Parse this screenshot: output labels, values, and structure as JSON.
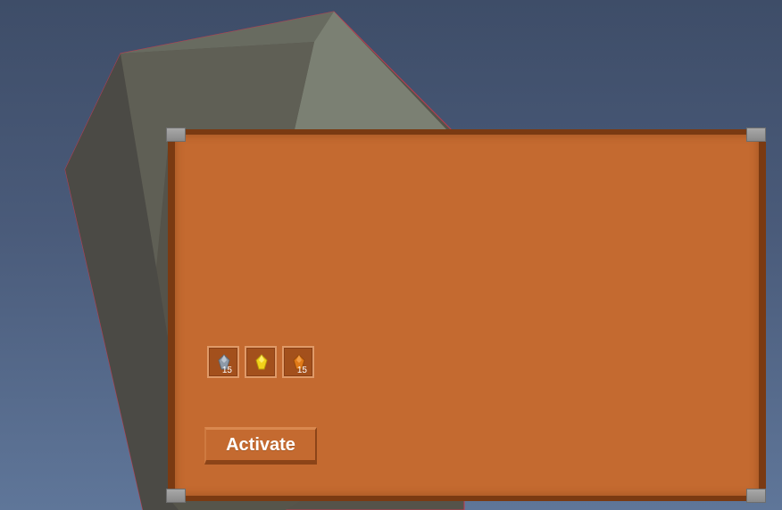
{
  "panel": {
    "background_color": "#c46a30",
    "border_color": "#7a3a12"
  },
  "inventory": {
    "slots": [
      {
        "icon": "gray-gem-icon",
        "color": "#8e9aa8",
        "count": "15"
      },
      {
        "icon": "yellow-gem-icon",
        "color": "#f2d21a",
        "count": ""
      },
      {
        "icon": "orange-gem-icon",
        "color": "#e07a18",
        "count": "15"
      }
    ]
  },
  "activate_label": "Activate"
}
